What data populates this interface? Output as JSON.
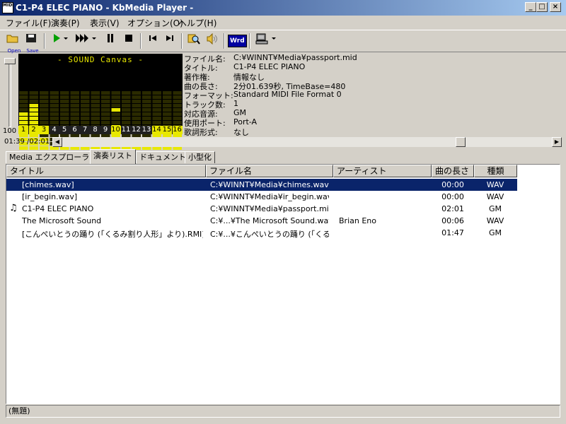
{
  "window": {
    "title": "C1-P4 ELEC PIANO - KbMedia Player -",
    "icon_text": "MIDI",
    "controls": [
      "_",
      "□",
      "×"
    ]
  },
  "menu": [
    "ファイル(F)",
    "演奏(P)",
    "表示(V)",
    "オプション(O)",
    "ヘルプ(H)"
  ],
  "toolbar": {
    "open_label": "Open",
    "save_label": "Save",
    "wrd_label": "Wrd",
    "icons": [
      "folder-open-icon",
      "save-icon",
      "play-icon",
      "fast-forward-icon",
      "pause-icon",
      "stop-icon",
      "previous-track-icon",
      "next-track-icon",
      "search-icon",
      "speaker-icon",
      "wrd-icon",
      "console-icon"
    ]
  },
  "volume": {
    "value": "100",
    "level": 1.0
  },
  "sound_canvas": {
    "title": "- SOUND Canvas -",
    "channels": [
      "1",
      "2",
      "3",
      "4",
      "5",
      "6",
      "7",
      "8",
      "9",
      "10",
      "11",
      "12",
      "13",
      "14",
      "15",
      "16"
    ],
    "levels": [
      0.61,
      0.79,
      0.18,
      0.07,
      0.07,
      0.07,
      0.07,
      0.07,
      0.07,
      0.43,
      0.07,
      0.07,
      0.07,
      0.32,
      0.36,
      0.25
    ],
    "peaks": [
      0.0,
      0.0,
      0.0,
      0.0,
      0.0,
      0.0,
      0.0,
      0.0,
      0.0,
      0.68,
      0.0,
      0.0,
      0.0,
      0.0,
      0.0,
      0.0
    ],
    "color": "#e8e800"
  },
  "info": {
    "rows": [
      {
        "key": "ファイル名:",
        "value": "C:¥WINNT¥Media¥passport.mid"
      },
      {
        "key": "タイトル:",
        "value": "C1-P4 ELEC PIANO"
      },
      {
        "key": "著作権:",
        "value": "情報なし"
      },
      {
        "key": "曲の長さ:",
        "value": "2分01.639秒, TimeBase=480"
      },
      {
        "key": "フォーマット:",
        "value": "Standard MIDI File Format 0"
      },
      {
        "key": "トラック数:",
        "value": "1"
      },
      {
        "key": "対応音源:",
        "value": "GM"
      },
      {
        "key": "使用ポート:",
        "value": "Port-A"
      },
      {
        "key": "歌詞形式:",
        "value": "なし"
      }
    ]
  },
  "position": {
    "label": "01:39 /02:01",
    "fraction": 0.82
  },
  "tabs": [
    "Media エクスプローラ",
    "演奏リスト",
    "ドキュメント",
    "小型化"
  ],
  "playlist": {
    "columns": [
      "タイトル",
      "ファイル名",
      "アーティスト",
      "曲の長さ",
      "種類"
    ],
    "rows": [
      {
        "title": "[chimes.wav]",
        "file": "C:¥WINNT¥Media¥chimes.wav",
        "artist": "",
        "length": "00:00",
        "type": "WAV",
        "selected": true,
        "playing": false
      },
      {
        "title": "[ir_begin.wav]",
        "file": "C:¥WINNT¥Media¥ir_begin.wav",
        "artist": "",
        "length": "00:00",
        "type": "WAV",
        "selected": false,
        "playing": false
      },
      {
        "title": "C1-P4 ELEC PIANO",
        "file": "C:¥WINNT¥Media¥passport.mid",
        "artist": "",
        "length": "02:01",
        "type": "GM",
        "selected": false,
        "playing": true
      },
      {
        "title": "The Microsoft Sound",
        "file": "C:¥...¥The Microsoft Sound.wav",
        "artist": "Brian Eno",
        "length": "00:06",
        "type": "WAV",
        "selected": false,
        "playing": false
      },
      {
        "title": "[こんぺいとうの踊り (「くるみ割り人形」より).RMI]",
        "file": "C:¥...¥こんぺいとうの踊り (「くる...",
        "artist": "",
        "length": "01:47",
        "type": "GM",
        "selected": false,
        "playing": false
      }
    ]
  },
  "status": "(無題)",
  "colors": {
    "selection": "#0a246a",
    "title_start": "#0a246a",
    "title_end": "#a6caf0",
    "face": "#d4d0c8"
  }
}
